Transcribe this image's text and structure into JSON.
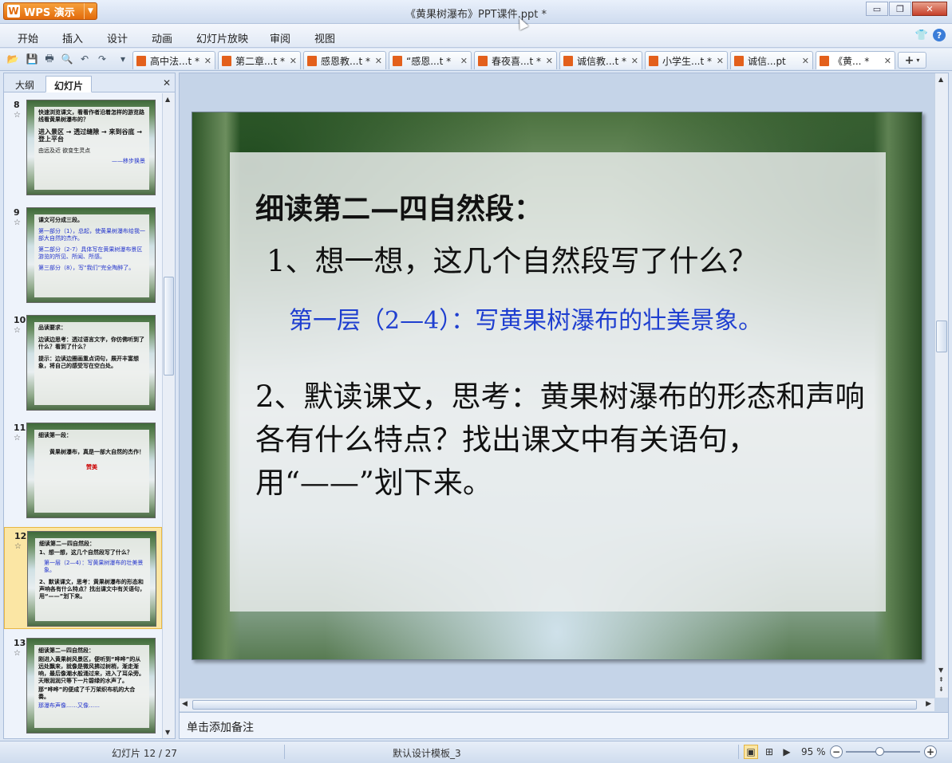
{
  "app": {
    "button_label": "WPS 演示",
    "logo_letter": "W",
    "window_title": "《黄果树瀑布》PPT课件.ppt *"
  },
  "window_controls": {
    "minimize": "▭",
    "maximize": "❐",
    "close": "✕"
  },
  "menu": {
    "items": [
      "开始",
      "插入",
      "设计",
      "动画",
      "幻灯片放映",
      "审阅",
      "视图"
    ],
    "help_icon": "?",
    "skin_icon": "👕"
  },
  "tabs": [
    {
      "label": "高中法...t *",
      "close": "✕"
    },
    {
      "label": "第二章...t *",
      "close": "✕"
    },
    {
      "label": "感恩教...t *",
      "close": "✕"
    },
    {
      "label": "“感恩...t *",
      "close": "✕"
    },
    {
      "label": "春夜喜...t *",
      "close": "✕"
    },
    {
      "label": "诚信教...t *",
      "close": "✕"
    },
    {
      "label": "小学生...t *",
      "close": "✕"
    },
    {
      "label": "诚信...pt",
      "close": "✕"
    },
    {
      "label": "《黄... *",
      "close": "✕"
    }
  ],
  "new_tab_label": "+",
  "left_panel": {
    "tab_outline": "大纲",
    "tab_slides": "幻灯片",
    "close": "✕",
    "thumbnails": [
      {
        "num": "8",
        "lines": [
          "快速浏览课文，看看作者沿着怎样的游览路线看黄果树瀑布的？",
          "进入景区 → 透过缝隙 → 来到谷底 → 登上平台",
          "由远及近  欲变生灵点",
          "——移步换景"
        ]
      },
      {
        "num": "9",
        "lines": [
          "课文可分成三段。",
          "第一部分（1），总起，使黄果树瀑布给我一部大自然的杰作。",
          "第二部分（2-7）具体写在黄果树瀑布景区游览的所见、所闻、所感。",
          "第三部分（8），写“我们”完全陶醉了。"
        ]
      },
      {
        "num": "10",
        "lines": [
          "品读要求：",
          "边读边思考：透过语言文字，你仿佛听到了什么？看到了什么？",
          "提示：边读边圈画重点词句，展开丰富想象，将自己的感受写在空白处。"
        ]
      },
      {
        "num": "11",
        "lines": [
          "细读第一段：",
          "黄果树瀑布，真是一部大自然的杰作！",
          "赞美"
        ]
      },
      {
        "num": "12",
        "lines": [
          "细读第二—四自然段：",
          "1、想一想，这几个自然段写了什么？",
          "第一层（2—4）：写黄果树瀑布的壮美景象。",
          "2、默读课文，思考：黄果树瀑布的形态和声响各有什么特点？找出课文中有关语句，用“——”划下来。"
        ]
      },
      {
        "num": "13",
        "lines": [
          "细读第二—四自然段：",
          "刚进入黄果树风景区，便听到“哗哗”的从远处飘来，就像是微风拂过树梢，渐走渐响，最后像潮水般涌过来，进入了耳朵旁。天眼润润只等下一片碧绿的水声了。",
          "那“哗哗”的便成了千万架织布机的大合奏。",
          "那瀑布声像……又像……"
        ]
      }
    ]
  },
  "slide": {
    "title": "细读第二—四自然段：",
    "question1": "1、想一想，这几个自然段写了什么？",
    "answer1": "第一层（2—4）：写黄果树瀑布的壮美景象。",
    "question2": "2、默读课文，思考：黄果树瀑布的形态和声响各有什么特点？找出课文中有关语句，用“——”划下来。"
  },
  "notes_placeholder": "单击添加备注",
  "status": {
    "slide_counter": "幻灯片 12 / 27",
    "template": "默认设计模板_3",
    "zoom": "95 %",
    "zoom_out": "−",
    "zoom_in": "+"
  },
  "colors": {
    "accent_orange": "#e36b0b",
    "answer_blue": "#1f3fd0",
    "selection_yellow": "#fbe6a4"
  }
}
